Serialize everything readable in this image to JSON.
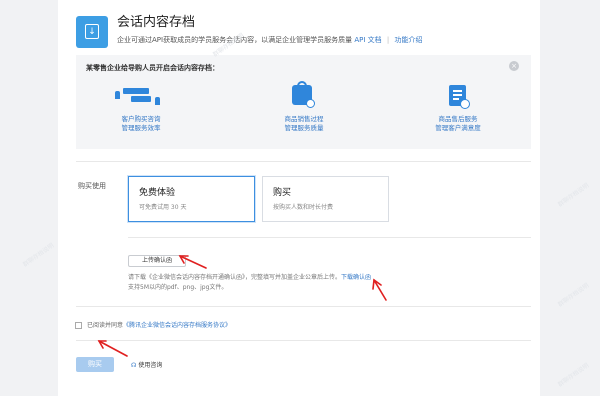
{
  "header": {
    "title": "会话内容存档",
    "subtitle": "企业可通过API获取成员的学员服务会话内容，以满足企业管理学员服务质量",
    "api_doc": "API 文档",
    "separator": "|",
    "intro": "功能介绍"
  },
  "promo": {
    "title": "某零售企业给导购人员开启会话内容存档：",
    "close_icon": "close-icon",
    "features": [
      {
        "icon": "people-chat-icon",
        "line1": "客户购买咨询",
        "line2": "管理服务效率"
      },
      {
        "icon": "shopping-bag-icon",
        "line1": "商品销售过程",
        "line2": "管理服务质量"
      },
      {
        "icon": "document-service-icon",
        "line1": "商品售后服务",
        "line2": "管理客户满意度"
      }
    ]
  },
  "purchase": {
    "label": "购买使用",
    "options": [
      {
        "name": "免费体验",
        "desc": "可免费试用 30 天",
        "selected": true
      },
      {
        "name": "购买",
        "desc": "按购买人数和时长付费",
        "selected": false
      }
    ]
  },
  "upload": {
    "button": "上传确认函",
    "hint": "请下载《企业微信会话内容存档开通确认函》，完整填写并加盖企业公章后上传。",
    "download_link": "下载确认函",
    "types": "支持5M以内的pdf、png、jpg文件。"
  },
  "agreement": {
    "checked": false,
    "text": "已阅读并同意",
    "link": "《腾讯企业微信会话内容存档服务协议》"
  },
  "footer": {
    "buy_button": "购买",
    "consult": "使用咨询",
    "consult_icon": "headset-icon"
  },
  "watermark": "群聊存档说明",
  "colors": {
    "accent": "#3d9ee4",
    "link": "#3478c6",
    "annotation_arrow": "#e02020",
    "buy_disabled": "#a8cbef"
  }
}
